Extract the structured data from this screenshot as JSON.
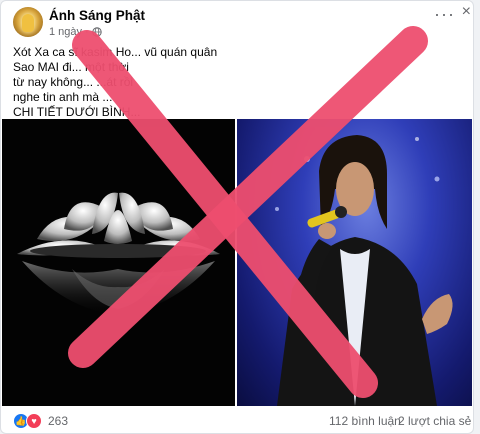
{
  "post": {
    "author": "Ánh Sáng Phật",
    "time": "1 ngày",
    "dot": "·",
    "more_label": "···",
    "close_label": "×",
    "text_lines": [
      "Xót Xa ca sĩ  kasim Ho... vũ quán quân",
      "Sao MAI đi...                   một thời",
      "từ nay không...                 ...át rồi",
      "nghe tin anh mà ...",
      "CHI TIẾT DƯỚI BÌNH..."
    ]
  },
  "stats": {
    "reaction_count": "263",
    "comments": "112 bình luận",
    "shares": "2 lượt chia sẻ",
    "reaction_icons": [
      "like-icon",
      "love-icon"
    ]
  },
  "colors": {
    "red_x": "#ee4e6f",
    "like": "#1877f2",
    "love": "#f33e58"
  }
}
